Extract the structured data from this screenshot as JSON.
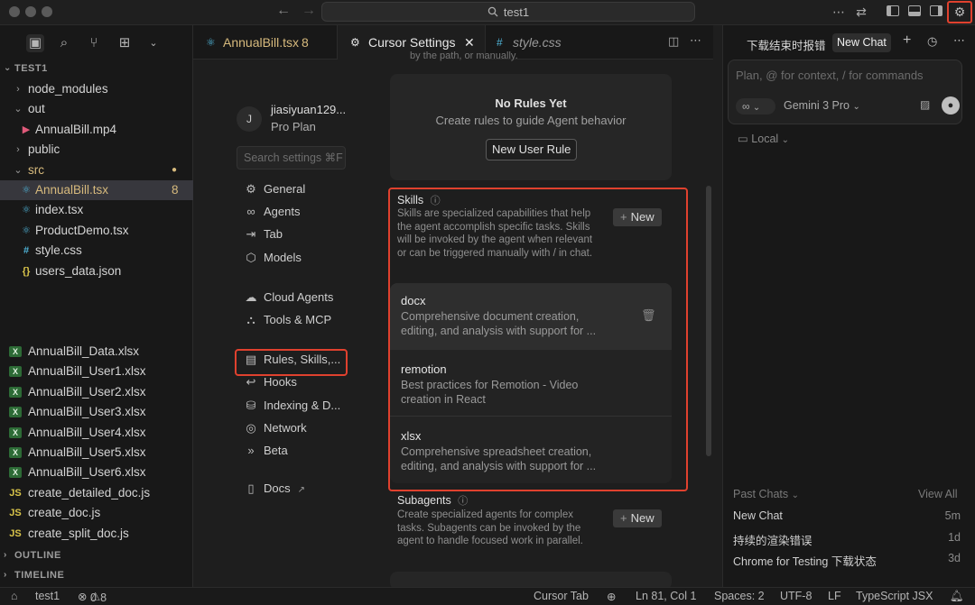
{
  "titlebar": {
    "search_text": "test1"
  },
  "explorer": {
    "project": "TEST1",
    "tree": [
      {
        "label": "node_modules",
        "type": "folder",
        "twist": "›"
      },
      {
        "label": "out",
        "type": "folder",
        "twist": "⌄"
      },
      {
        "label": "AnnualBill.mp4",
        "type": "video"
      },
      {
        "label": "public",
        "type": "folder",
        "twist": "›"
      },
      {
        "label": "src",
        "type": "folder",
        "twist": "⌄"
      },
      {
        "label": "AnnualBill.tsx",
        "type": "react",
        "badge": "8"
      },
      {
        "label": "index.tsx",
        "type": "react"
      },
      {
        "label": "ProductDemo.tsx",
        "type": "react"
      },
      {
        "label": "style.css",
        "type": "css"
      },
      {
        "label": "users_data.json",
        "type": "json"
      }
    ],
    "files2": [
      {
        "label": "AnnualBill_Data.xlsx",
        "type": "xlsx"
      },
      {
        "label": "AnnualBill_User1.xlsx",
        "type": "xlsx"
      },
      {
        "label": "AnnualBill_User2.xlsx",
        "type": "xlsx"
      },
      {
        "label": "AnnualBill_User3.xlsx",
        "type": "xlsx"
      },
      {
        "label": "AnnualBill_User4.xlsx",
        "type": "xlsx"
      },
      {
        "label": "AnnualBill_User5.xlsx",
        "type": "xlsx"
      },
      {
        "label": "AnnualBill_User6.xlsx",
        "type": "xlsx"
      },
      {
        "label": "create_detailed_doc.js",
        "type": "js"
      },
      {
        "label": "create_doc.js",
        "type": "js"
      },
      {
        "label": "create_split_doc.js",
        "type": "js"
      }
    ],
    "outline": "OUTLINE",
    "timeline": "TIMELINE"
  },
  "tabs": [
    {
      "label": "AnnualBill.tsx",
      "badge": "8"
    },
    {
      "label": "Cursor Settings"
    },
    {
      "label": "style.css"
    }
  ],
  "settings": {
    "user_initial": "J",
    "user_name": "jiasiyuan129...",
    "plan": "Pro Plan",
    "search_placeholder": "Search settings ⌘F",
    "nav": [
      {
        "label": "General",
        "icon": "⚙"
      },
      {
        "label": "Agents",
        "icon": "∞"
      },
      {
        "label": "Tab",
        "icon": "⇥"
      },
      {
        "label": "Models",
        "icon": "⬡"
      },
      {
        "label": "Cloud Agents",
        "icon": "☁"
      },
      {
        "label": "Tools & MCP",
        "icon": "⛬"
      },
      {
        "label": "Rules, Skills,...",
        "icon": "▤"
      },
      {
        "label": "Hooks",
        "icon": "↩"
      },
      {
        "label": "Indexing & D...",
        "icon": "⛁"
      },
      {
        "label": "Network",
        "icon": "◎"
      },
      {
        "label": "Beta",
        "icon": "»"
      },
      {
        "label": "Docs",
        "icon": "▯"
      }
    ],
    "top_fragment": "by the path, or manually.",
    "rules": {
      "title": "No Rules Yet",
      "subtitle": "Create rules to guide Agent behavior",
      "button": "New User Rule"
    },
    "skills": {
      "title": "Skills",
      "description": "Skills are specialized capabilities that help the agent accomplish specific tasks. Skills will be invoked by the agent when relevant or can be triggered manually with / in chat.",
      "new_button": "New",
      "items": [
        {
          "name": "docx",
          "desc": "Comprehensive document creation, editing, and analysis with support for ..."
        },
        {
          "name": "remotion",
          "desc": "Best practices for Remotion - Video creation in React"
        },
        {
          "name": "xlsx",
          "desc": "Comprehensive spreadsheet creation, editing, and analysis with support for ..."
        }
      ]
    },
    "subagents": {
      "title": "Subagents",
      "description": "Create specialized agents for complex tasks. Subagents can be invoked by the agent to handle focused work in parallel.",
      "new_button": "New"
    }
  },
  "chat": {
    "tab_title": "下载结束时报错",
    "new_chat": "New Chat",
    "input_placeholder": "Plan, @ for context, / for commands",
    "mode": "∞",
    "model": "Gemini 3 Pro",
    "location": "Local",
    "past_chats_label": "Past Chats",
    "view_all": "View All",
    "past_chats": [
      {
        "title": "New Chat",
        "time": "5m"
      },
      {
        "title": "持续的渲染错误",
        "time": "1d"
      },
      {
        "title": "Chrome for Testing 下载状态",
        "time": "3d"
      }
    ]
  },
  "status": {
    "project": "test1",
    "errors": "0",
    "warnings": "8",
    "cursor_tab": "Cursor Tab",
    "position": "Ln 81, Col 1",
    "spaces": "Spaces: 2",
    "encoding": "UTF-8",
    "eol": "LF",
    "language": "TypeScript JSX"
  },
  "colors": {
    "highlight": "#e0412e",
    "react": "#4fb4d8",
    "xlsx": "#3fa34d",
    "js": "#d9c44a",
    "modified": "#d7ba7d"
  }
}
